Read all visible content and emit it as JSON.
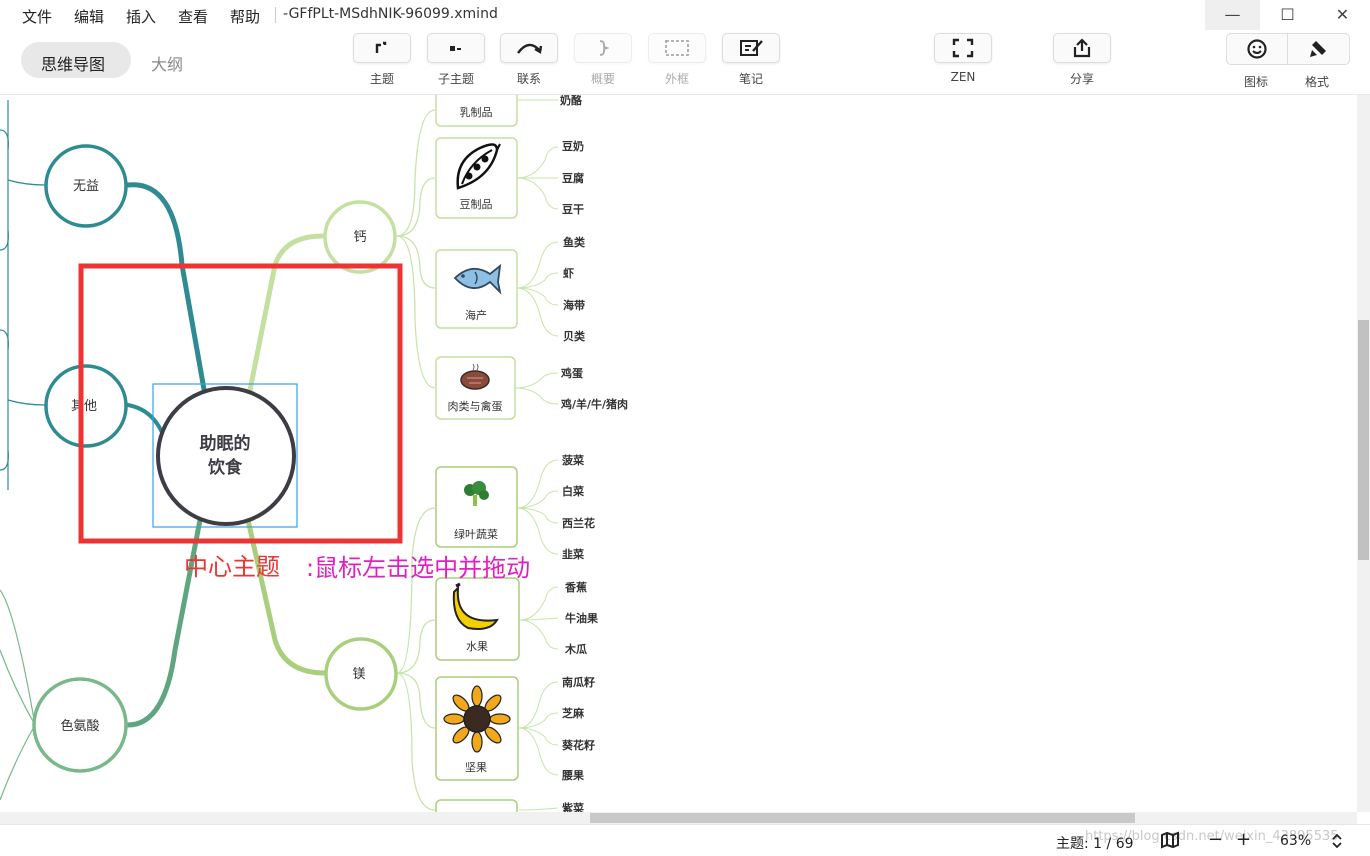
{
  "menu": {
    "items": [
      "文件",
      "编辑",
      "插入",
      "查看",
      "帮助"
    ],
    "document_title": "-GFfPLt-MSdhNIK-96099.xmind"
  },
  "window": {
    "minimize": "—",
    "maximize": "☐",
    "close": "✕"
  },
  "view_tabs": {
    "mindmap": "思维导图",
    "outline": "大纲"
  },
  "toolbar": {
    "topic": "主题",
    "subtopic": "子主题",
    "relationship": "联系",
    "summary": "概要",
    "boundary": "外框",
    "note": "笔记",
    "zen": "ZEN",
    "share": "分享",
    "icons": "图标",
    "format": "格式"
  },
  "mindmap": {
    "central": {
      "line1": "助眠的",
      "line2": "饮食"
    },
    "left_topics": {
      "useless": "无益",
      "other": "其他",
      "tryptophan": "色氨酸"
    },
    "calcium": {
      "label": "钙",
      "groups": {
        "dairy": {
          "label": "乳制品",
          "items": [
            "奶酪"
          ]
        },
        "soy": {
          "label": "豆制品",
          "items": [
            "豆奶",
            "豆腐",
            "豆干"
          ]
        },
        "seafood": {
          "label": "海产",
          "items": [
            "鱼类",
            "虾",
            "海带",
            "贝类"
          ]
        },
        "meat": {
          "label": "肉类与禽蛋",
          "items": [
            "鸡蛋",
            "鸡/羊/牛/猪肉"
          ]
        }
      }
    },
    "magnesium": {
      "label": "镁",
      "groups": {
        "greens": {
          "label": "绿叶蔬菜",
          "items": [
            "菠菜",
            "白菜",
            "西兰花",
            "韭菜"
          ]
        },
        "fruit": {
          "label": "水果",
          "items": [
            "香蕉",
            "牛油果",
            "木瓜"
          ]
        },
        "nuts": {
          "label": "坚果",
          "items": [
            "南瓜籽",
            "芝麻",
            "葵花籽",
            "腰果"
          ]
        },
        "partial": {
          "items": [
            "紫菜"
          ]
        }
      }
    },
    "annotation": {
      "title": "中心主题",
      "hint": ":鼠标左击选中并拖动"
    }
  },
  "status": {
    "topic_count": "主题: 1 / 69",
    "zoom_out": "−",
    "zoom_in": "+",
    "zoom": "63%",
    "watermark": "https://blog.csdn.net/weixin_43895535"
  },
  "colors": {
    "teal": "#2e8b92",
    "green_light": "#c3e0a0",
    "green": "#a9cf7c",
    "annotation_red": "#ee3333",
    "annotation_magenta": "#e020c0",
    "selection": "#3aa0e8"
  }
}
